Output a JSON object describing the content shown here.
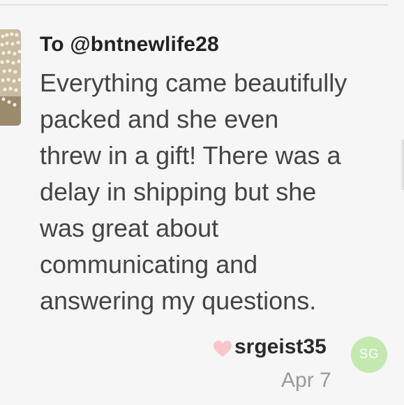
{
  "review": {
    "recipient": "To @bntnewlife28",
    "comment_lines": [
      "Everything came beautifully",
      "packed and she even",
      "threw in a gift! There was a",
      "delay in shipping but she",
      "was great about",
      "communicating and",
      "answering my questions."
    ],
    "author": "srgeist35",
    "avatar_initials": "SG",
    "date": "Apr 7",
    "icons": {
      "like": "heart-icon",
      "item": "pearl-necklace-thumbnail"
    },
    "colors": {
      "avatar_bg": "#c3e8b0",
      "heart": "#f7c6cc",
      "text_primary": "#222222",
      "text_body": "#444444",
      "text_muted": "#9a9a9a"
    }
  }
}
